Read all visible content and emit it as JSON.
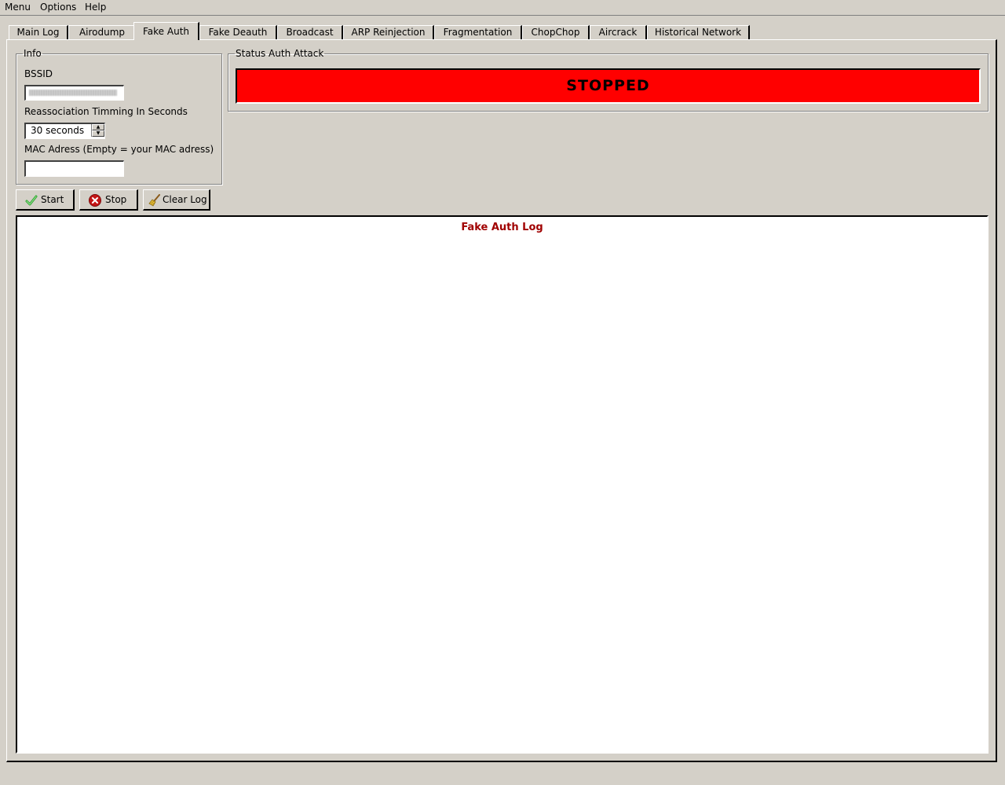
{
  "menubar": {
    "items": [
      "Menu",
      "Options",
      "Help"
    ]
  },
  "tabs": [
    {
      "label": "Main Log"
    },
    {
      "label": "Airodump"
    },
    {
      "label": "Fake Auth"
    },
    {
      "label": "Fake Deauth"
    },
    {
      "label": "Broadcast"
    },
    {
      "label": "ARP Reinjection"
    },
    {
      "label": "Fragmentation"
    },
    {
      "label": "ChopChop"
    },
    {
      "label": "Aircrack"
    },
    {
      "label": "Historical Network"
    }
  ],
  "active_tab": "Fake Auth",
  "info": {
    "title": "Info",
    "bssid_label": "BSSID",
    "reassoc_label": "Reassociation Timming In Seconds",
    "reassoc_value": "30 seconds",
    "mac_label": "MAC Adress (Empty = your MAC adress)",
    "mac_value": ""
  },
  "status": {
    "title": "Status Auth Attack",
    "value": "STOPPED",
    "color": "#ff0000"
  },
  "buttons": {
    "start": "Start",
    "stop": "Stop",
    "clear_log": "Clear Log"
  },
  "log": {
    "title": "Fake Auth Log",
    "title_color": "#a00000"
  },
  "icons": {
    "start": "check-icon",
    "stop": "stop-circle-icon",
    "clear_log": "broom-icon"
  }
}
